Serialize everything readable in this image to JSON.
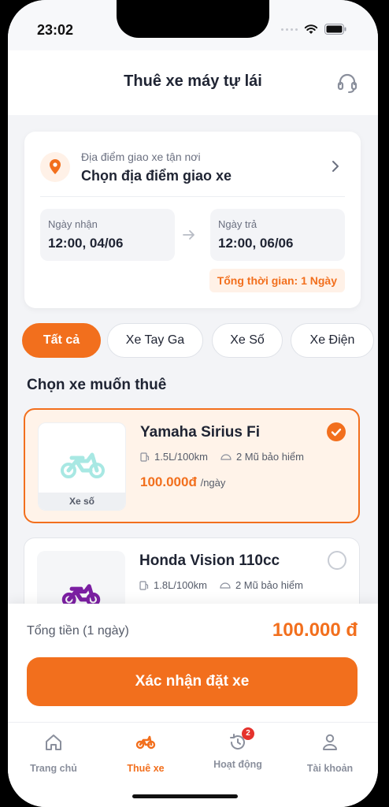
{
  "status_bar": {
    "time": "23:02"
  },
  "header": {
    "title": "Thuê xe máy tự lái",
    "support_icon": "headset-icon"
  },
  "location": {
    "subtitle": "Địa điểm giao xe tận nơi",
    "title": "Chọn địa điểm giao xe"
  },
  "dates": {
    "pickup_label": "Ngày nhận",
    "pickup_value": "12:00, 04/06",
    "return_label": "Ngày trả",
    "return_value": "12:00, 06/06",
    "duration": "Tổng thời gian: 1 Ngày"
  },
  "filters": [
    {
      "label": "Tất cả",
      "active": true
    },
    {
      "label": "Xe Tay Ga",
      "active": false
    },
    {
      "label": "Xe Số",
      "active": false
    },
    {
      "label": "Xe Điện",
      "active": false
    }
  ],
  "section_title": "Chọn xe muốn thuê",
  "bikes": [
    {
      "name": "Yamaha Sirius Fi",
      "fuel": "1.5L/100km",
      "helmets": "2 Mũ bảo hiểm",
      "price": "100.000đ",
      "price_unit": "/ngày",
      "type_label": "Xe số",
      "selected": true,
      "icon_color": "#a8e8e3"
    },
    {
      "name": "Honda Vision 110cc",
      "fuel": "1.8L/100km",
      "helmets": "2 Mũ bảo hiểm",
      "selected": false,
      "icon_color": "#7b1fa2"
    }
  ],
  "summary": {
    "total_label": "Tổng tiền (1 ngày)",
    "total_value": "100.000 đ",
    "confirm_label": "Xác nhận đặt xe"
  },
  "tabs": [
    {
      "label": "Trang chủ",
      "icon": "home-icon",
      "active": false
    },
    {
      "label": "Thuê xe",
      "icon": "motorbike-icon",
      "active": true
    },
    {
      "label": "Hoạt động",
      "icon": "history-icon",
      "active": false,
      "badge": "2"
    },
    {
      "label": "Tài khoản",
      "icon": "user-icon",
      "active": false
    }
  ],
  "colors": {
    "accent": "#f26f1d",
    "accent_light": "#fff1e7",
    "badge": "#e5322d"
  }
}
